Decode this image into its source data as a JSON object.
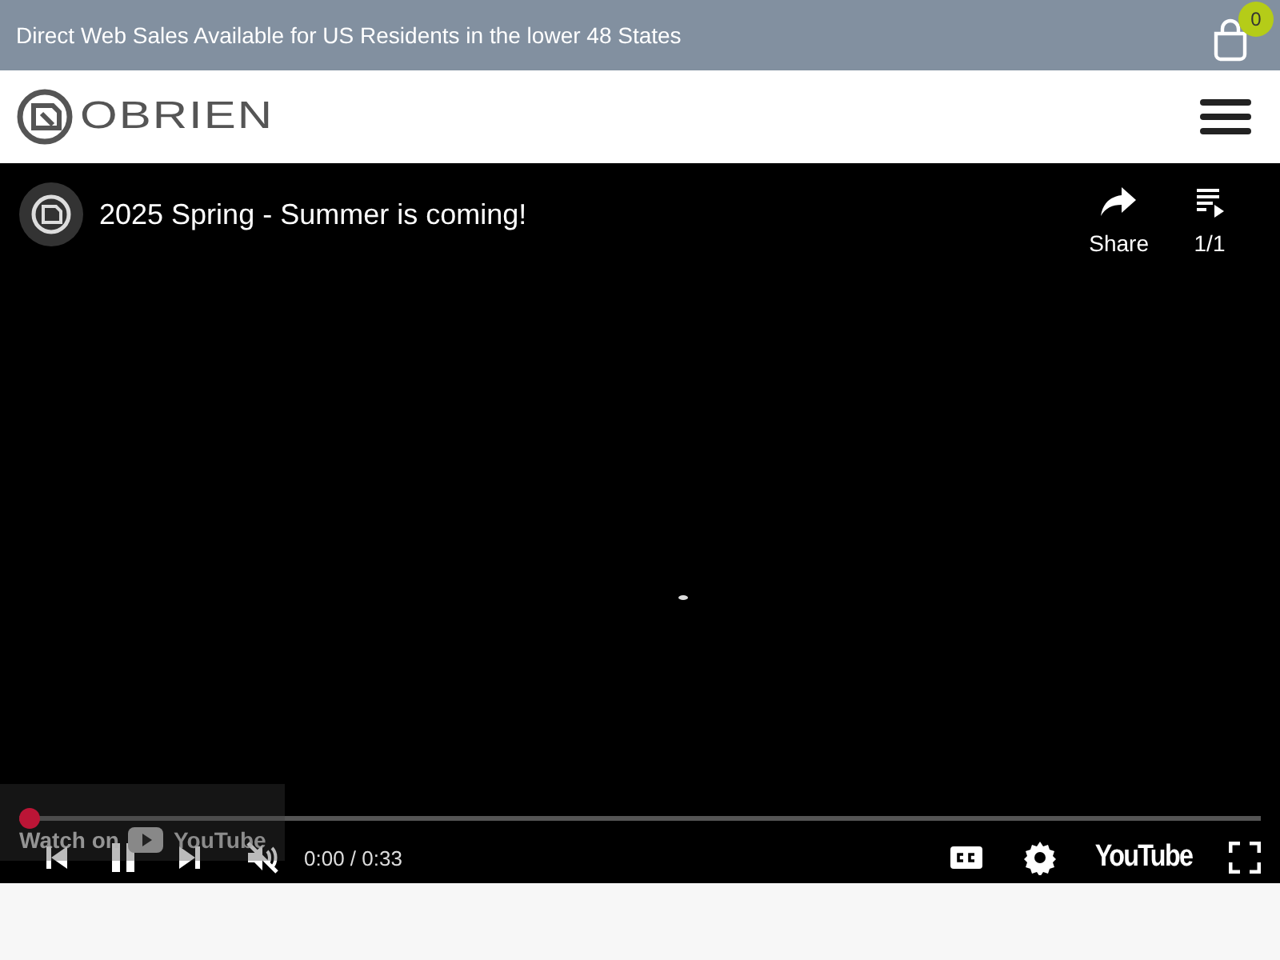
{
  "announcement": "Direct Web Sales Available for US Residents in the lower 48 States",
  "cart": {
    "count": "0"
  },
  "header": {
    "logo": "OBRIEN"
  },
  "video": {
    "title": "2025 Spring - Summer is coming!",
    "actions": [
      {
        "kind": "share",
        "label": "Share"
      },
      {
        "kind": "playlist",
        "label": "1/1"
      }
    ],
    "watch_on": {
      "text": "Watch on",
      "brand": "YouTube"
    },
    "progress": {
      "level": 0
    },
    "playing": true,
    "muted": true,
    "time": "0:00 / 0:33",
    "brand": "YouTube"
  }
}
